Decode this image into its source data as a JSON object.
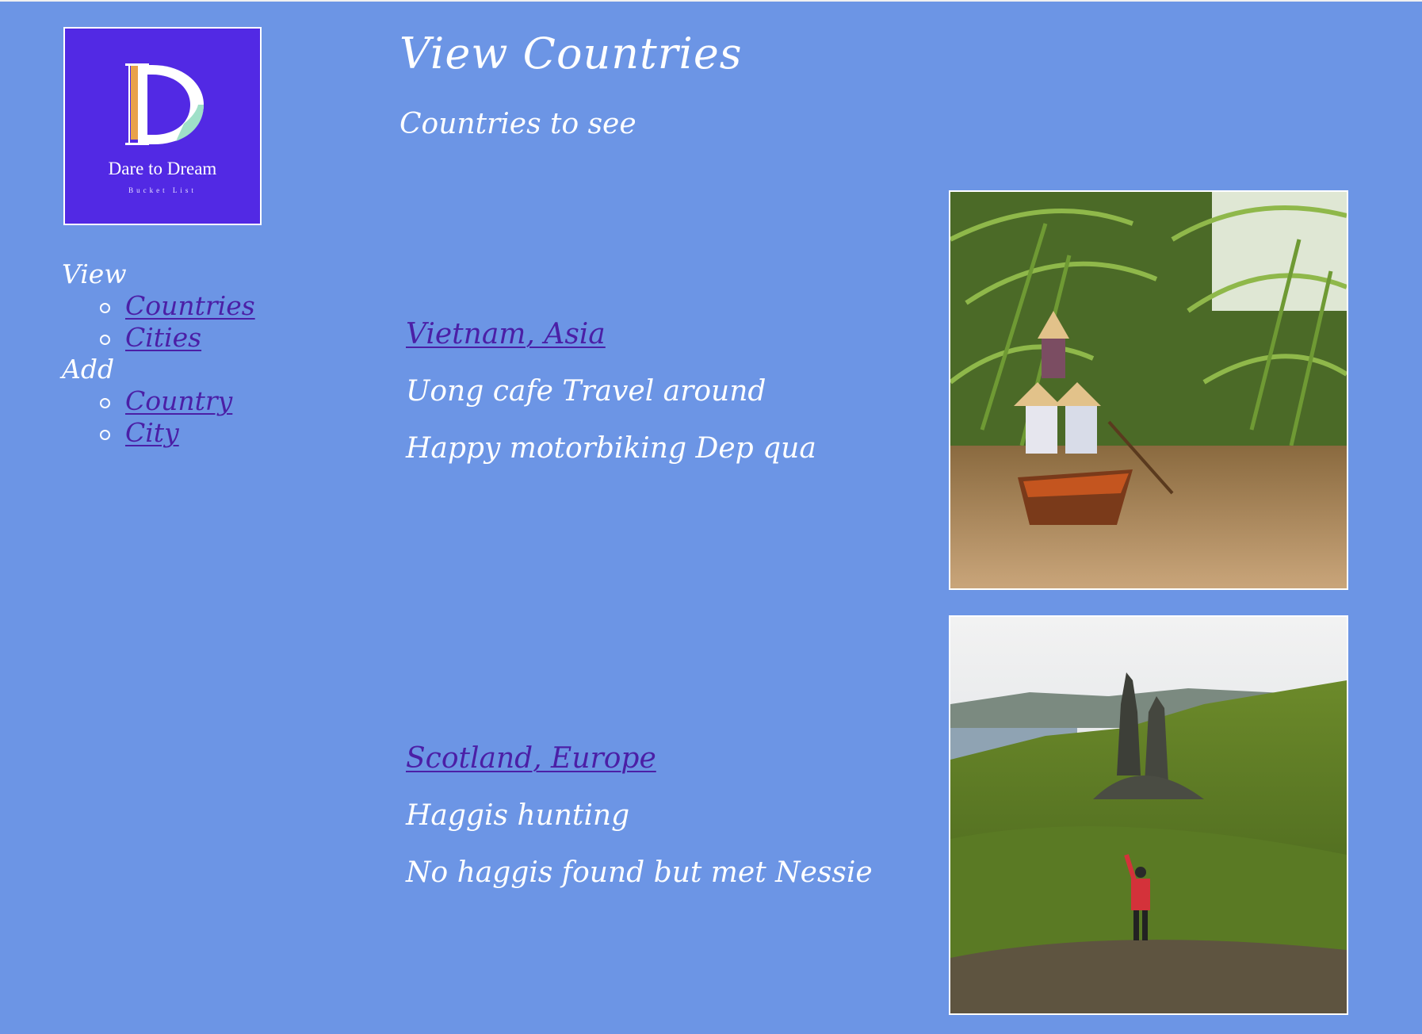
{
  "logo": {
    "name": "Dare to Dream",
    "sub": "Bucket List"
  },
  "nav": {
    "view_heading": "View",
    "view_items": [
      {
        "label": "Countries"
      },
      {
        "label": "Cities"
      }
    ],
    "add_heading": "Add",
    "add_items": [
      {
        "label": "Country"
      },
      {
        "label": "City"
      }
    ]
  },
  "main": {
    "title": "View Countries",
    "subtitle": "Countries to see",
    "countries": [
      {
        "link": "Vietnam, Asia",
        "line1": "Uong cafe Travel around",
        "line2": "Happy motorbiking Dep qua",
        "image": "river-boat-palms-photo"
      },
      {
        "link": "Scotland, Europe",
        "line1": "Haggis hunting",
        "line2": "No haggis found but met Nessie",
        "image": "highland-rock-pinnacle-photo"
      }
    ]
  },
  "colors": {
    "background": "#6c95e5",
    "link": "#4b1fa6",
    "logo_bg": "#5229e4",
    "text": "#ffffff"
  }
}
